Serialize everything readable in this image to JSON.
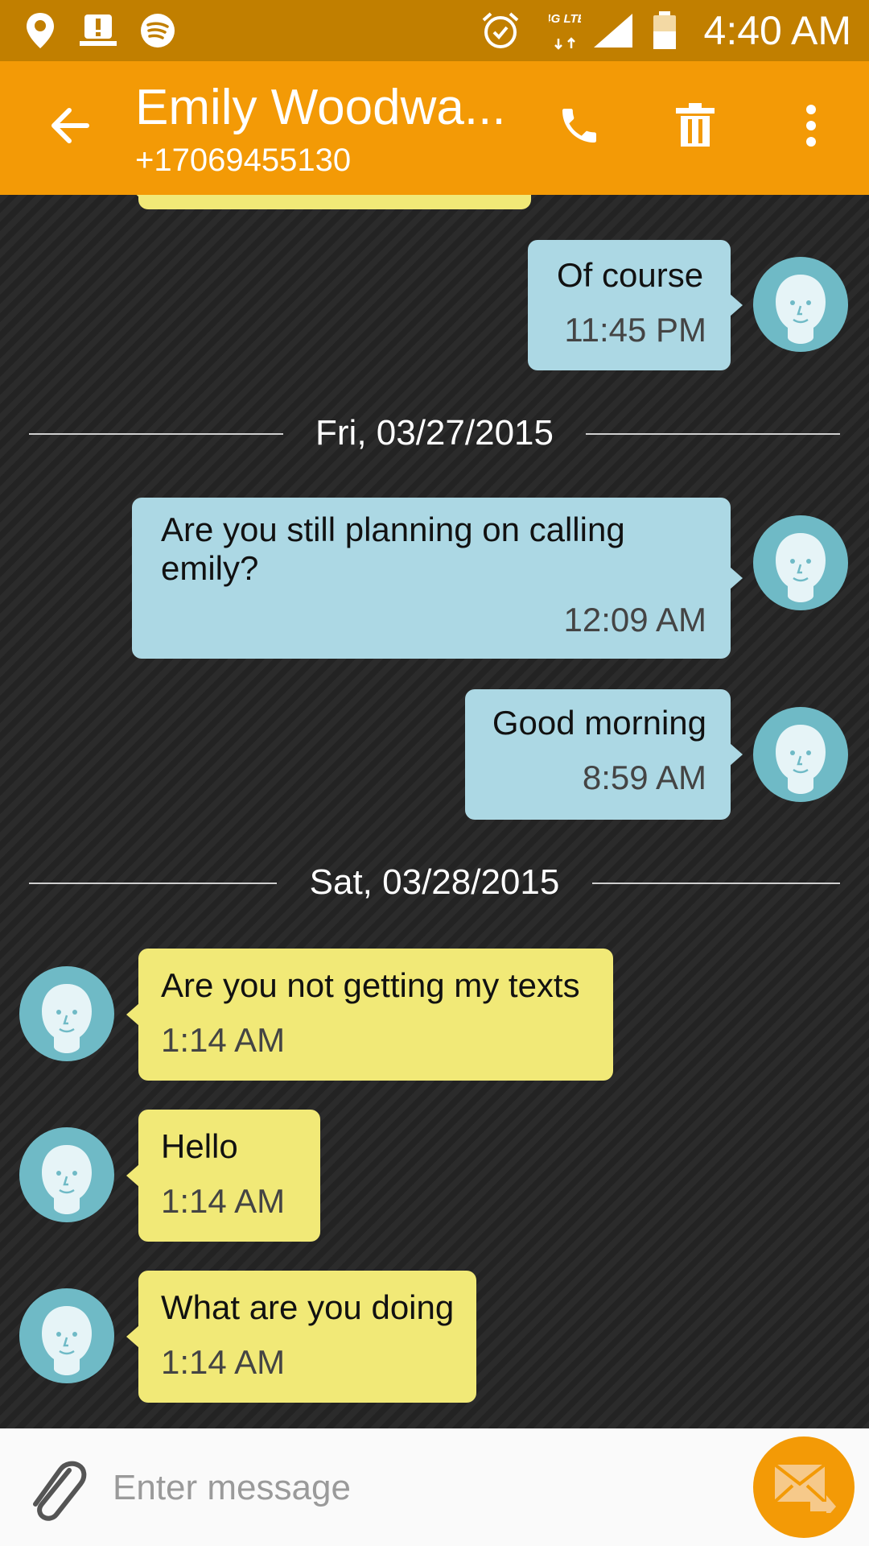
{
  "status_bar": {
    "time": "4:40 AM",
    "icons": [
      "location-icon",
      "alert-icon",
      "spotify-icon",
      "alarm-icon",
      "4g-lte-icon",
      "signal-icon",
      "battery-icon"
    ],
    "network_label": "4G LTE"
  },
  "header": {
    "title": "Emily Woodwa...",
    "subtitle": "+17069455130",
    "actions": [
      "call-icon",
      "delete-icon",
      "more-icon"
    ]
  },
  "messages": [
    {
      "dir": "out",
      "text": "Of course",
      "time": "11:45 PM"
    },
    {
      "date": "Fri, 03/27/2015"
    },
    {
      "dir": "out",
      "text": "Are you still planning on calling emily?",
      "time": "12:09 AM"
    },
    {
      "dir": "out",
      "text": "Good morning",
      "time": "8:59 AM"
    },
    {
      "date": "Sat, 03/28/2015"
    },
    {
      "dir": "in",
      "text": "Are you not getting my texts",
      "time": "1:14 AM"
    },
    {
      "dir": "in",
      "text": "Hello",
      "time": "1:14 AM"
    },
    {
      "dir": "in",
      "text": "What are you doing",
      "time": "1:14 AM"
    }
  ],
  "compose": {
    "placeholder": "Enter message"
  },
  "colors": {
    "status_bar": "#c17f00",
    "app_bar": "#f39a06",
    "outgoing_bubble": "#acd8e4",
    "incoming_bubble": "#f1e977",
    "background": "#232323"
  }
}
